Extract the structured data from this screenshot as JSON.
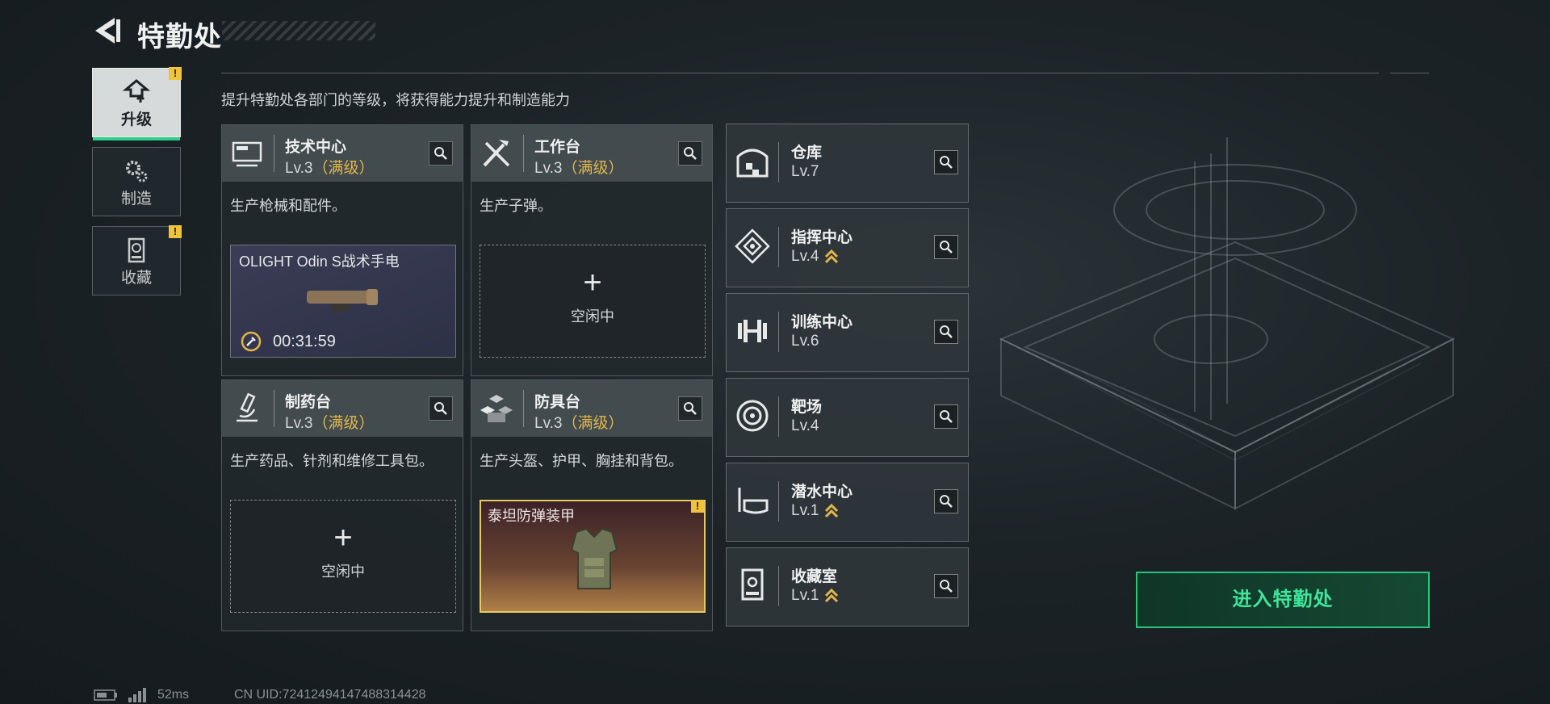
{
  "header": {
    "title": "特勤处",
    "subtitle": "提升特勤处各部门的等级，将获得能力提升和制造能力"
  },
  "nav": [
    {
      "label": "升级",
      "active": true,
      "alert": "!"
    },
    {
      "label": "制造",
      "active": false
    },
    {
      "label": "收藏",
      "active": false,
      "alert": "!"
    }
  ],
  "cards": [
    {
      "name": "技术中心",
      "level": "Lv.3",
      "max": "（满级）",
      "desc": "生产枪械和配件。",
      "slot": {
        "item": "OLIGHT Odin S战术手电",
        "timer": "00:31:59"
      }
    },
    {
      "name": "工作台",
      "level": "Lv.3",
      "max": "（满级）",
      "desc": "生产子弹。",
      "slot": {
        "idle_label": "空闲中",
        "plus": "+"
      }
    },
    {
      "name": "制药台",
      "level": "Lv.3",
      "max": "（满级）",
      "desc": "生产药品、针剂和维修工具包。",
      "slot": {
        "idle_label": "空闲中",
        "plus": "+"
      }
    },
    {
      "name": "防具台",
      "level": "Lv.3",
      "max": "（满级）",
      "desc": "生产头盔、护甲、胸挂和背包。",
      "slot": {
        "item": "泰坦防弹装甲",
        "alert": "!"
      }
    }
  ],
  "departments": [
    {
      "name": "仓库",
      "level": "Lv.7",
      "upgrade": false
    },
    {
      "name": "指挥中心",
      "level": "Lv.4",
      "upgrade": true
    },
    {
      "name": "训练中心",
      "level": "Lv.6",
      "upgrade": false
    },
    {
      "name": "靶场",
      "level": "Lv.4",
      "upgrade": false
    },
    {
      "name": "潜水中心",
      "level": "Lv.1",
      "upgrade": true
    },
    {
      "name": "收藏室",
      "level": "Lv.1",
      "upgrade": true
    }
  ],
  "enter_button": "进入特勤处",
  "status": {
    "ping": "52ms",
    "uid": "CN UID:72412494147488314428"
  },
  "colors": {
    "accent": "#2fd08a",
    "max": "#e3b64a",
    "alert": "#f0c33c"
  }
}
